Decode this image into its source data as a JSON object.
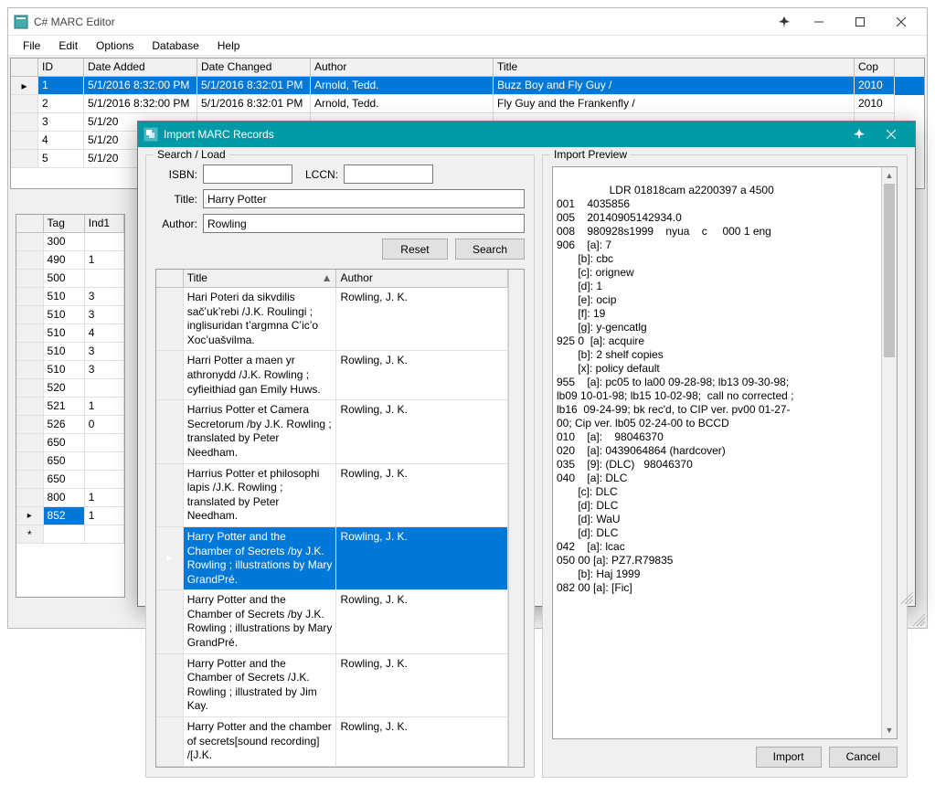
{
  "main": {
    "title": "C# MARC Editor",
    "menu": [
      "File",
      "Edit",
      "Options",
      "Database",
      "Help"
    ],
    "grid": {
      "headers": {
        "id": "ID",
        "date_added": "Date Added",
        "date_changed": "Date Changed",
        "author": "Author",
        "title": "Title",
        "copyright": "Cop"
      },
      "rows": [
        {
          "id": "1",
          "da": "5/1/2016 8:32:00 PM",
          "dc": "5/1/2016 8:32:01 PM",
          "author": "Arnold, Tedd.",
          "title": "Buzz Boy and Fly Guy /",
          "cp": "2010",
          "selected": true
        },
        {
          "id": "2",
          "da": "5/1/2016 8:32:00 PM",
          "dc": "5/1/2016 8:32:01 PM",
          "author": "Arnold, Tedd.",
          "title": "Fly Guy and the Frankenfly /",
          "cp": "2010"
        },
        {
          "id": "3",
          "da": "5/1/20",
          "dc": "",
          "author": "",
          "title": "",
          "cp": ""
        },
        {
          "id": "4",
          "da": "5/1/20",
          "dc": "",
          "author": "",
          "title": "",
          "cp": ""
        },
        {
          "id": "5",
          "da": "5/1/20",
          "dc": "",
          "author": "",
          "title": "",
          "cp": ""
        }
      ]
    },
    "tags": {
      "headers": {
        "tag": "Tag",
        "ind1": "Ind1"
      },
      "rows": [
        {
          "tag": "300",
          "ind": ""
        },
        {
          "tag": "490",
          "ind": "1"
        },
        {
          "tag": "500",
          "ind": ""
        },
        {
          "tag": "510",
          "ind": "3"
        },
        {
          "tag": "510",
          "ind": "3"
        },
        {
          "tag": "510",
          "ind": "4"
        },
        {
          "tag": "510",
          "ind": "3"
        },
        {
          "tag": "510",
          "ind": "3"
        },
        {
          "tag": "520",
          "ind": ""
        },
        {
          "tag": "521",
          "ind": "1"
        },
        {
          "tag": "526",
          "ind": "0"
        },
        {
          "tag": "650",
          "ind": ""
        },
        {
          "tag": "650",
          "ind": ""
        },
        {
          "tag": "650",
          "ind": ""
        },
        {
          "tag": "800",
          "ind": "1"
        },
        {
          "tag": "852",
          "ind": "1",
          "hl": true,
          "arrow": true
        },
        {
          "tag": "",
          "ind": "",
          "star": true
        }
      ]
    }
  },
  "dialog": {
    "title": "Import MARC Records",
    "left": {
      "panel_title": "Search / Load",
      "labels": {
        "isbn": "ISBN:",
        "lccn": "LCCN:",
        "title": "Title:",
        "author": "Author:"
      },
      "values": {
        "isbn": "",
        "lccn": "",
        "title": "Harry Potter",
        "author": "Rowling"
      },
      "buttons": {
        "reset": "Reset",
        "search": "Search"
      },
      "results": {
        "headers": {
          "title": "Title",
          "author": "Author"
        },
        "rows": [
          {
            "t": "Hari Poteri da sikvdilis sačʼukʼrebi /J.K. Roulingi ; inglisuridan tʼargmna Cʼicʼo Xocʼuašvilma.",
            "a": "Rowling, J. K."
          },
          {
            "t": "Harri Potter a maen yr athronydd /J.K. Rowling ; cyfieithiad gan Emily Huws.",
            "a": "Rowling, J. K."
          },
          {
            "t": "Harrius Potter et Camera Secretorum /by J.K. Rowling ; translated by Peter Needham.",
            "a": "Rowling, J. K."
          },
          {
            "t": "Harrius Potter et philosophi lapis /J.K. Rowling ; translated by Peter Needham.",
            "a": "Rowling, J. K."
          },
          {
            "t": "Harry Potter and the Chamber of Secrets /by J.K. Rowling ; illustrations by Mary GrandPré.",
            "a": "Rowling, J. K.",
            "selected": true
          },
          {
            "t": "Harry Potter and the Chamber of Secrets /by J.K. Rowling ; illustrations by Mary GrandPré.",
            "a": "Rowling, J. K."
          },
          {
            "t": "Harry Potter and the Chamber of Secrets /J.K. Rowling ; illustrated by Jim Kay.",
            "a": "Rowling, J. K."
          },
          {
            "t": "Harry Potter and the chamber of secrets[sound recording] /[J.K.",
            "a": "Rowling, J. K."
          }
        ]
      }
    },
    "right": {
      "panel_title": "Import Preview",
      "buttons": {
        "import": "Import",
        "cancel": "Cancel"
      },
      "preview": "LDR 01818cam a2200397 a 4500\n001    4035856\n005    20140905142934.0\n008    980928s1999    nyua    c     000 1 eng\n906    [a]: 7\n       [b]: cbc\n       [c]: orignew\n       [d]: 1\n       [e]: ocip\n       [f]: 19\n       [g]: y-gencatlg\n925 0  [a]: acquire\n       [b]: 2 shelf copies\n       [x]: policy default\n955    [a]: pc05 to la00 09-28-98; lb13 09-30-98;\nlb09 10-01-98; lb15 10-02-98;  call no corrected ;\nlb16  09-24-99; bk rec'd, to CIP ver. pv00 01-27-\n00; Cip ver. lb05 02-24-00 to BCCD\n010    [a]:    98046370\n020    [a]: 0439064864 (hardcover)\n035    [9]: (DLC)   98046370\n040    [a]: DLC\n       [c]: DLC\n       [d]: DLC\n       [d]: WaU\n       [d]: DLC\n042    [a]: lcac\n050 00 [a]: PZ7.R79835\n       [b]: Haj 1999\n082 00 [a]: [Fic]"
    }
  }
}
